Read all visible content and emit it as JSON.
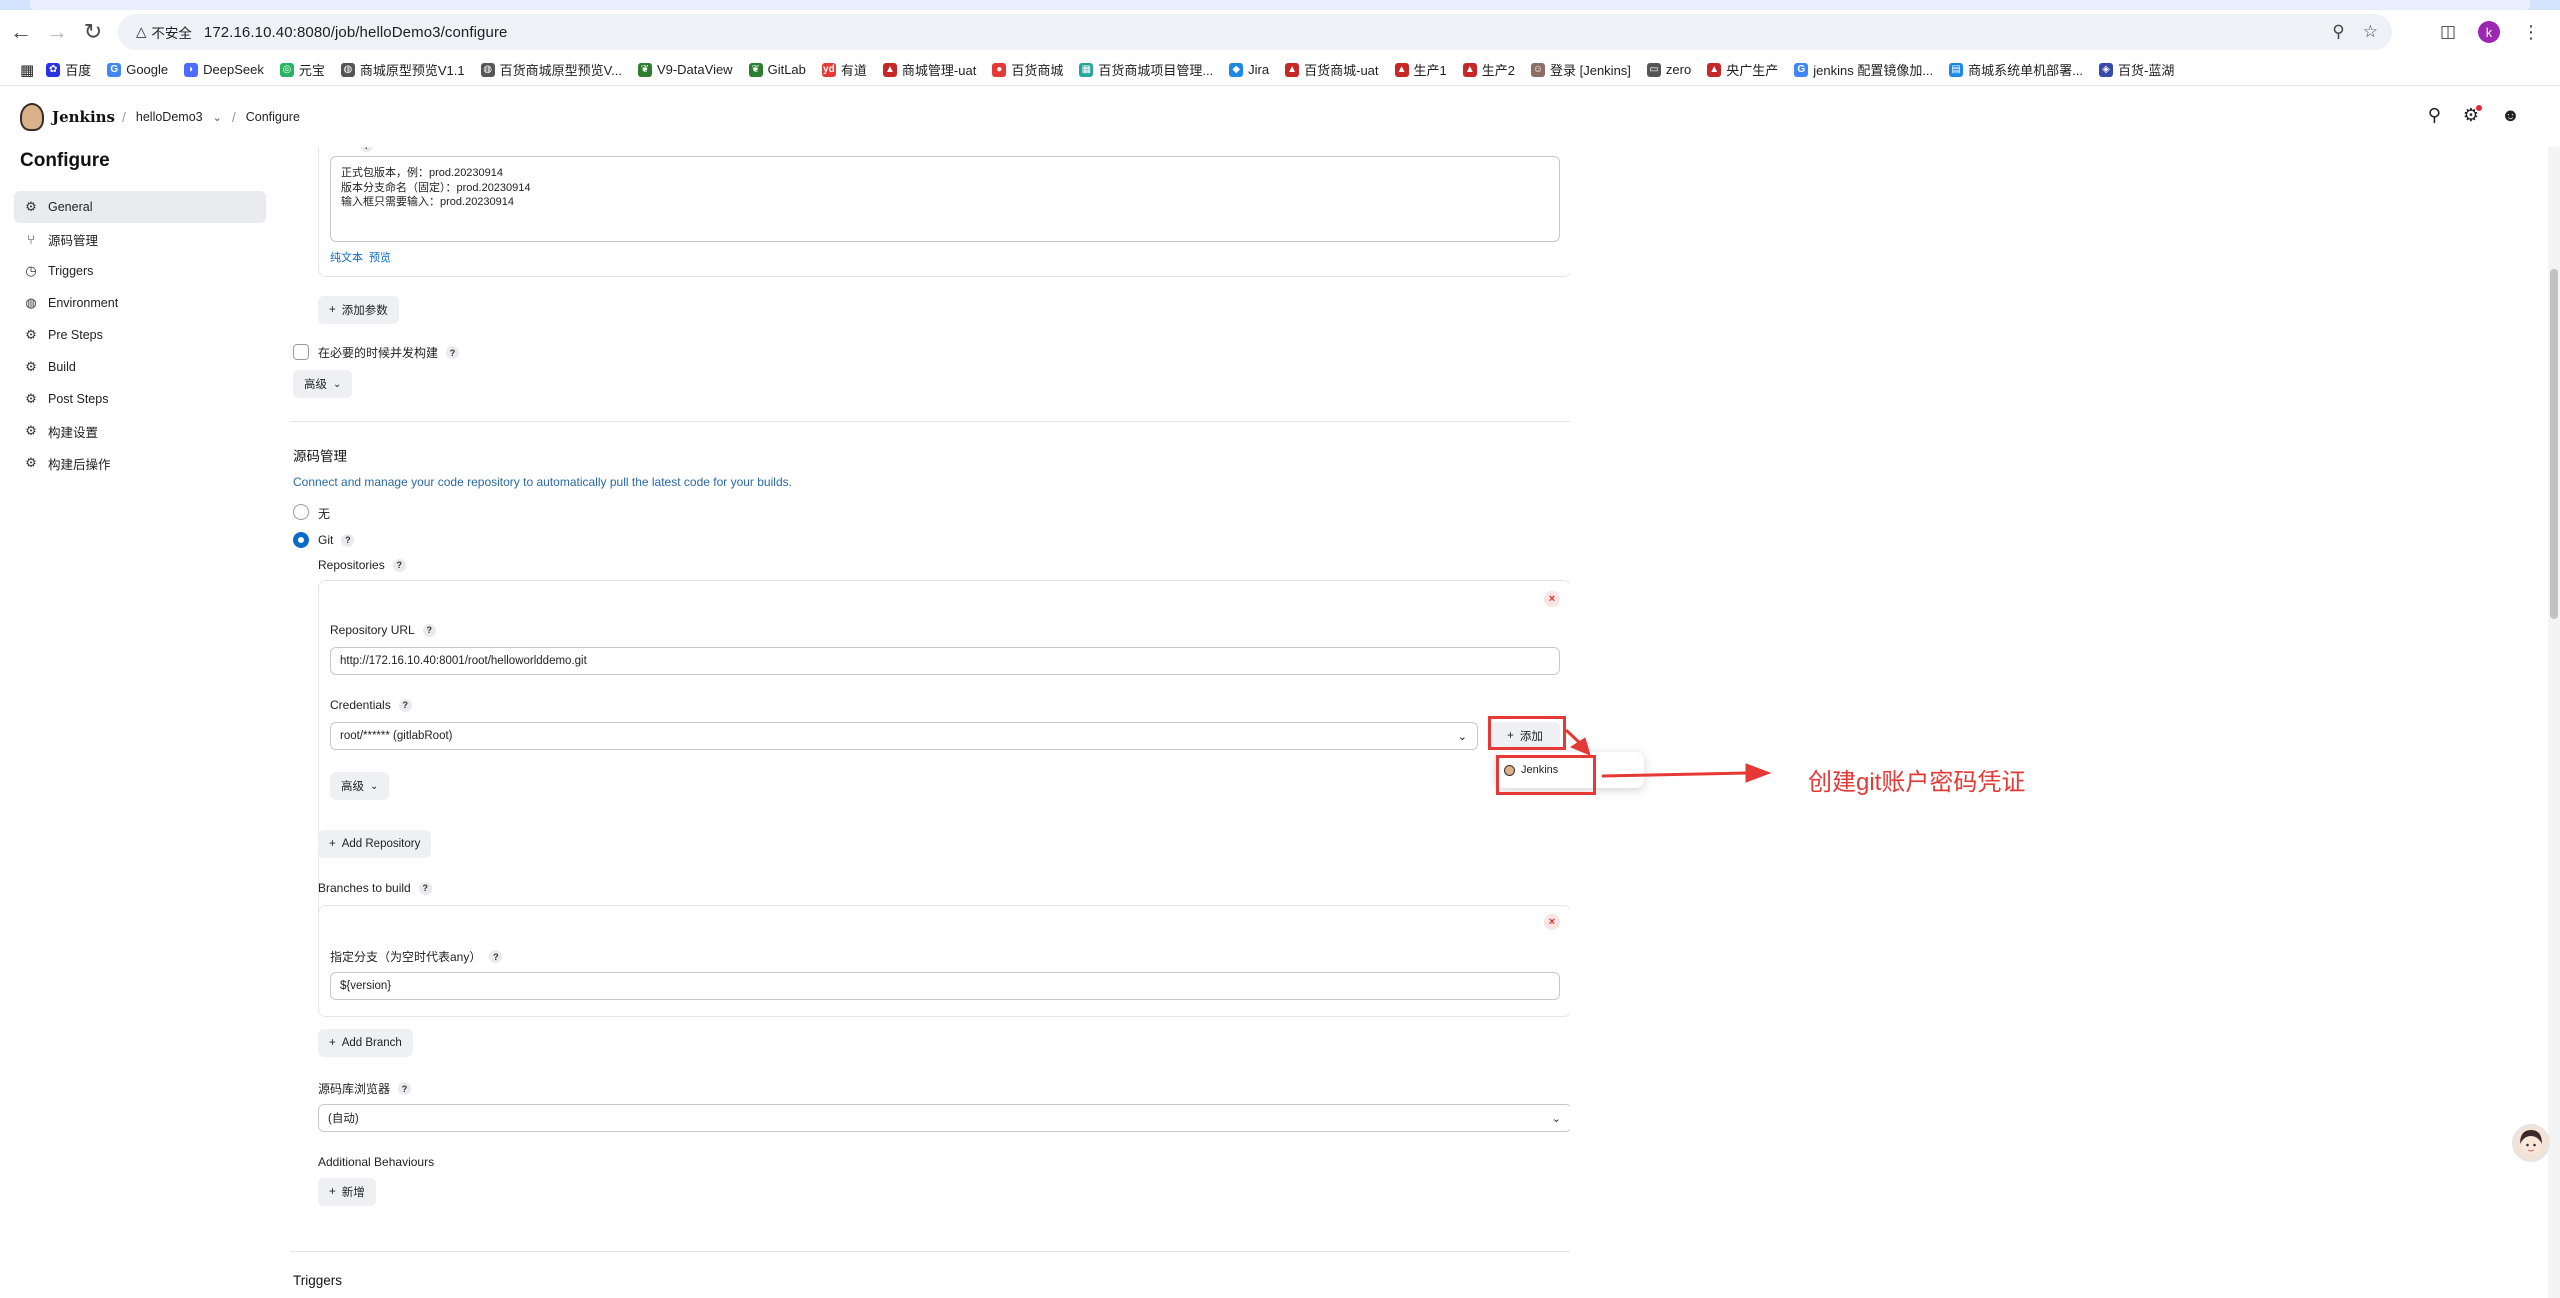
{
  "browser": {
    "security_label": "不安全",
    "url": "172.16.10.40:8080/job/helloDemo3/configure",
    "profile_initial": "k"
  },
  "bookmarks": [
    {
      "label": "百度",
      "icon": "paw-icon",
      "color": "#2932e1"
    },
    {
      "label": "Google",
      "icon": "google-icon",
      "color": "#4285f4"
    },
    {
      "label": "DeepSeek",
      "icon": "whale-icon",
      "color": "#4d6bfe"
    },
    {
      "label": "元宝",
      "icon": "yuanbao-icon",
      "color": "#28b463"
    },
    {
      "label": "商城原型预览V1.1",
      "icon": "globe-icon",
      "color": "#555555"
    },
    {
      "label": "百货商城原型预览V...",
      "icon": "globe-icon",
      "color": "#555555"
    },
    {
      "label": "V9-DataView",
      "icon": "leaf-icon",
      "color": "#2e7d32"
    },
    {
      "label": "GitLab",
      "icon": "leaf-icon",
      "color": "#2e7d32"
    },
    {
      "label": "有道",
      "icon": "youdao-icon",
      "color": "#e53935"
    },
    {
      "label": "商城管理-uat",
      "icon": "bookmark-icon",
      "color": "#c62828"
    },
    {
      "label": "百货商城",
      "icon": "shop-icon",
      "color": "#e53935"
    },
    {
      "label": "百货商城项目管理...",
      "icon": "board-icon",
      "color": "#26a69a"
    },
    {
      "label": "Jira",
      "icon": "jira-icon",
      "color": "#1e88e5"
    },
    {
      "label": "百货商城-uat",
      "icon": "bookmark-icon",
      "color": "#c62828"
    },
    {
      "label": "生产1",
      "icon": "bookmark-icon",
      "color": "#c62828"
    },
    {
      "label": "生产2",
      "icon": "bookmark-icon",
      "color": "#c62828"
    },
    {
      "label": "登录 [Jenkins]",
      "icon": "jenkins-icon",
      "color": "#8d6e63"
    },
    {
      "label": "zero",
      "icon": "folder-icon",
      "color": "#555555"
    },
    {
      "label": "央广生产",
      "icon": "bookmark-icon",
      "color": "#c62828"
    },
    {
      "label": "jenkins 配置镜像加...",
      "icon": "google-icon",
      "color": "#4285f4"
    },
    {
      "label": "商城系统单机部署...",
      "icon": "doc-icon",
      "color": "#1e88e5"
    },
    {
      "label": "百货-蓝湖",
      "icon": "lanhu-icon",
      "color": "#3949ab"
    }
  ],
  "jenkins": {
    "brand": "Jenkins",
    "breadcrumb_job": "helloDemo3",
    "breadcrumb_page": "Configure"
  },
  "sidebar": {
    "title": "Configure",
    "items": [
      {
        "label": "General",
        "icon": "gear-icon",
        "active": true
      },
      {
        "label": "源码管理",
        "icon": "branch-icon",
        "active": false
      },
      {
        "label": "Triggers",
        "icon": "clock-icon",
        "active": false
      },
      {
        "label": "Environment",
        "icon": "globe-icon",
        "active": false
      },
      {
        "label": "Pre Steps",
        "icon": "gear-icon",
        "active": false
      },
      {
        "label": "Build",
        "icon": "gear-icon",
        "active": false
      },
      {
        "label": "Post Steps",
        "icon": "gear-icon",
        "active": false
      },
      {
        "label": "构建设置",
        "icon": "gear-icon",
        "active": false
      },
      {
        "label": "构建后操作",
        "icon": "gear-icon",
        "active": false
      }
    ]
  },
  "general": {
    "description_lines": [
      "正式包版本，例：prod.20230914",
      "版本分支命名（固定）：prod.20230914",
      "输入框只需要输入：prod.20230914"
    ],
    "plain_text_link": "纯文本",
    "preview_link": "预览",
    "add_param_label": "添加参数",
    "concurrent_label": "在必要的时候并发构建",
    "advanced_label": "高级"
  },
  "scm": {
    "title": "源码管理",
    "description": "Connect and manage your code repository to automatically pull the latest code for your builds.",
    "option_none": "无",
    "option_git": "Git",
    "repositories_label": "Repositories",
    "repo_url_label": "Repository URL",
    "repo_url_value": "http://172.16.10.40:8001/root/helloworlddemo.git",
    "credentials_label": "Credentials",
    "credentials_value": "root/****** (gitlabRoot)",
    "add_label": "添加",
    "advanced_label": "高级",
    "add_repository_label": "Add Repository",
    "branches_label": "Branches to build",
    "branch_specifier_label": "指定分支（为空时代表any）",
    "branch_value": "${version}",
    "add_branch_label": "Add Branch",
    "repo_browser_label": "源码库浏览器",
    "repo_browser_value": "(自动)",
    "behaviours_label": "Additional Behaviours",
    "new_label": "新增"
  },
  "popup": {
    "item_label": "Jenkins"
  },
  "annotation": {
    "text": "创建git账户密码凭证",
    "color": "#e53935"
  },
  "triggers": {
    "title": "Triggers"
  },
  "colors": {
    "accent": "#0b6bcb",
    "annotation": "#e53935"
  }
}
